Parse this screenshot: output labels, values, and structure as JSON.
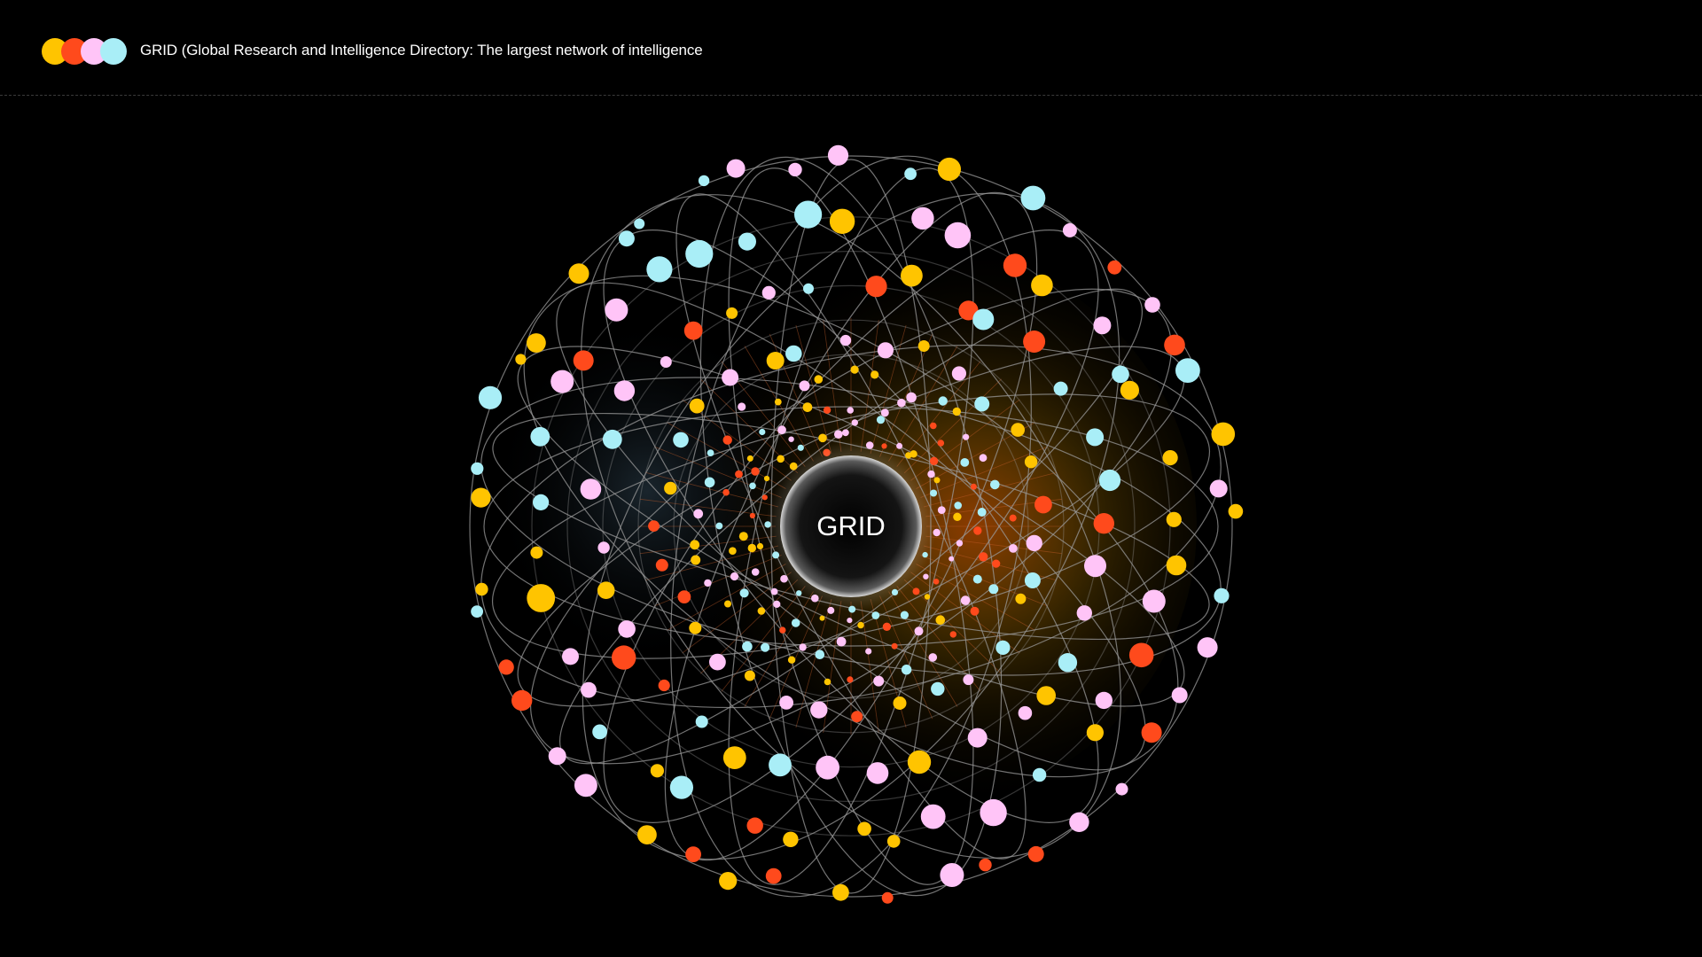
{
  "header": {
    "title": "GRID (Global Research and Intelligence Directory: The largest network of intelligence",
    "logo_colors": [
      "#ffc400",
      "#ff4a1c",
      "#ffc4f7",
      "#a9eef7"
    ]
  },
  "network": {
    "center_label": "GRID",
    "node_colors": [
      "#ffc400",
      "#ff4a1c",
      "#ffc4f7",
      "#a9eef7"
    ],
    "edge_color": "#9a9a9a",
    "glow_colors": [
      "#ff6a00",
      "#ffb000",
      "#4a6a80"
    ],
    "hub_color": "#1a1a1a"
  }
}
